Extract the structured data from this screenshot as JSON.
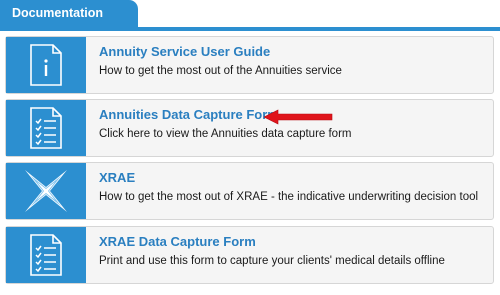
{
  "header": {
    "tab_label": "Documentation"
  },
  "items": [
    {
      "title": "Annuity Service User Guide",
      "description": "How to get the most out of the Annuities service",
      "icon": "document-info-icon"
    },
    {
      "title": "Annuities Data Capture Form",
      "description": "Click here to view the Annuities data capture form",
      "icon": "checklist-form-icon"
    },
    {
      "title": "XRAE",
      "description": "How to get the most out of XRAE - the indicative underwriting decision tool",
      "icon": "xrae-logo-icon"
    },
    {
      "title": "XRAE Data Capture Form",
      "description": "Print and use this form to capture your clients' medical details offline",
      "icon": "checklist-form-icon"
    }
  ],
  "colors": {
    "accent": "#2c8fd0",
    "link": "#2a7fc0",
    "arrow": "#e0141b"
  }
}
